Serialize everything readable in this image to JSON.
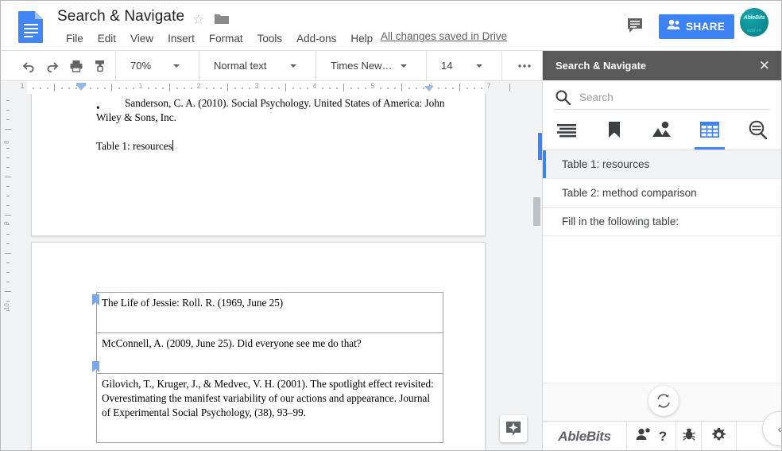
{
  "app": {
    "doc_title": "Search & Navigate",
    "saved_state": "All changes saved in Drive",
    "share_label": "SHARE",
    "avatar_name": "AbleBits",
    "avatar_sub": "add-in"
  },
  "menubar": {
    "items": [
      {
        "label": "File"
      },
      {
        "label": "Edit"
      },
      {
        "label": "View"
      },
      {
        "label": "Insert"
      },
      {
        "label": "Format"
      },
      {
        "label": "Tools"
      },
      {
        "label": "Add-ons"
      },
      {
        "label": "Help"
      }
    ]
  },
  "toolbar": {
    "zoom": "70%",
    "paragraph_style": "Normal text",
    "font_family": "Times New…",
    "font_size": "14",
    "more_label": "…"
  },
  "ruler": {
    "numbers_h": [
      "1",
      "1",
      "2",
      "3",
      "4",
      "5",
      "6",
      "7"
    ],
    "numbers_v": [
      "8",
      "9",
      "10"
    ]
  },
  "document": {
    "bullet_marker": "•",
    "paragraphs": [
      "Sanderson, C. A. (2010). Social Psychology. United States of America: John Wiley & Sons, Inc.",
      "Table 1: resources"
    ],
    "table_rows": [
      {
        "text": "The Life of Jessie: Roll. R. (1969, June 25)",
        "bookmarked": true
      },
      {
        "text": "McConnell, A. (2009, June 25). Did everyone see me do that?",
        "bookmarked": false
      },
      {
        "text": "Gilovich, T., Kruger, J., & Medvec, V. H. (2001). The spotlight effect revisited: Overestimating the manifest variability of our actions and appearance. Journal of Experimental Social Psychology, (38), 93–99.",
        "bookmarked": true
      }
    ]
  },
  "sidebar": {
    "title": "Search & Navigate",
    "close_label": "✕",
    "search": {
      "value": "",
      "placeholder": "Search"
    },
    "tabs": [
      {
        "name": "headings",
        "icon": "headings-icon",
        "active": false
      },
      {
        "name": "bookmarks",
        "icon": "bookmark-icon",
        "active": false
      },
      {
        "name": "images",
        "icon": "image-icon",
        "active": false
      },
      {
        "name": "tables",
        "icon": "table-icon",
        "active": true
      },
      {
        "name": "find",
        "icon": "find-icon",
        "active": false
      }
    ],
    "list_items": [
      {
        "label": "Table 1: resources",
        "active": true
      },
      {
        "label": "Table 2: method comparison",
        "active": false
      },
      {
        "label": "Fill in the following table:",
        "active": false
      }
    ],
    "footer": {
      "brand": "AbleBits",
      "help_label": "?"
    }
  },
  "colors": {
    "accent_blue": "#3b83f6",
    "sidebar_header": "#595959",
    "canvas_gray": "#f1f3f4"
  }
}
